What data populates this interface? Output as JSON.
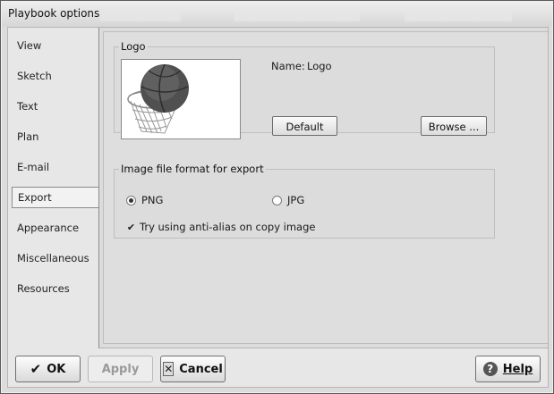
{
  "window": {
    "title": "Playbook options"
  },
  "sidebar": {
    "items": [
      {
        "label": "View"
      },
      {
        "label": "Sketch"
      },
      {
        "label": "Text"
      },
      {
        "label": "Plan"
      },
      {
        "label": "E-mail"
      },
      {
        "label": "Export"
      },
      {
        "label": "Appearance"
      },
      {
        "label": "Miscellaneous"
      },
      {
        "label": "Resources"
      }
    ],
    "active": "Export"
  },
  "logo_group": {
    "legend": "Logo",
    "name_label": "Name:",
    "name_value": "Logo",
    "default_button": "Default",
    "browse_button": "Browse ...",
    "image_icon": "basketball-hoop-icon"
  },
  "export_group": {
    "legend": "Image file format for export",
    "png_label": "PNG",
    "png_selected": true,
    "jpg_label": "JPG",
    "jpg_selected": false,
    "antialias_label": "Try using anti-alias on copy image",
    "antialias_checked": true
  },
  "footer": {
    "ok_label": "OK",
    "apply_label": "Apply",
    "cancel_label": "Cancel",
    "help_label": "Help"
  }
}
